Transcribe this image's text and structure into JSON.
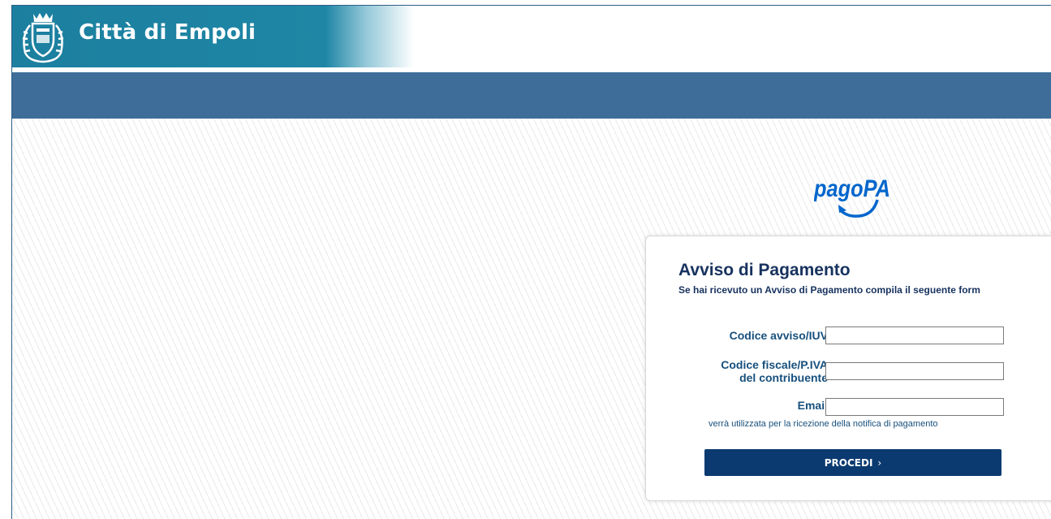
{
  "header": {
    "site_title": "Città di Empoli",
    "band_color": "#1f86a5",
    "nav_color": "#3f6d9a"
  },
  "brand": {
    "logo_text": "pagoPA",
    "logo_color": "#0066cc"
  },
  "form": {
    "title": "Avviso di Pagamento",
    "subtitle": "Se hai ricevuto un Avviso di Pagamento compila il seguente form",
    "fields": {
      "iuv": {
        "label": "Codice avviso/IUV",
        "value": ""
      },
      "cf": {
        "label_line1": "Codice fiscale/P.IVA",
        "label_line2": "del contribuente",
        "value": ""
      },
      "email": {
        "label": "Email",
        "value": "",
        "note": "verrà utilizzata per la ricezione della notifica di pagamento"
      }
    },
    "submit": {
      "label": "PROCEDI",
      "chevron": "›"
    }
  },
  "colors": {
    "title": "#17325e",
    "label": "#17507d",
    "button": "#0b3a71"
  }
}
